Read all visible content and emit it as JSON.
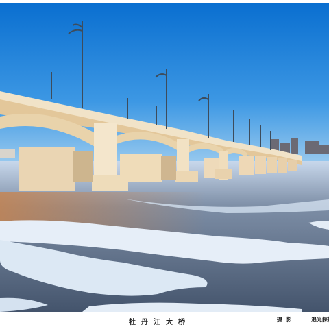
{
  "caption": {
    "title": "牡丹江大桥",
    "credit_label": "摄影",
    "credit_name": "追光探影"
  },
  "scene": {
    "subject": "bridge-photo",
    "colors": {
      "sky_top": "#0a6fd0",
      "sky_bottom": "#8cc4ee",
      "bridge": "#f2e2c4",
      "water": "#5a6f88",
      "ice": "#e8f0f8"
    }
  }
}
